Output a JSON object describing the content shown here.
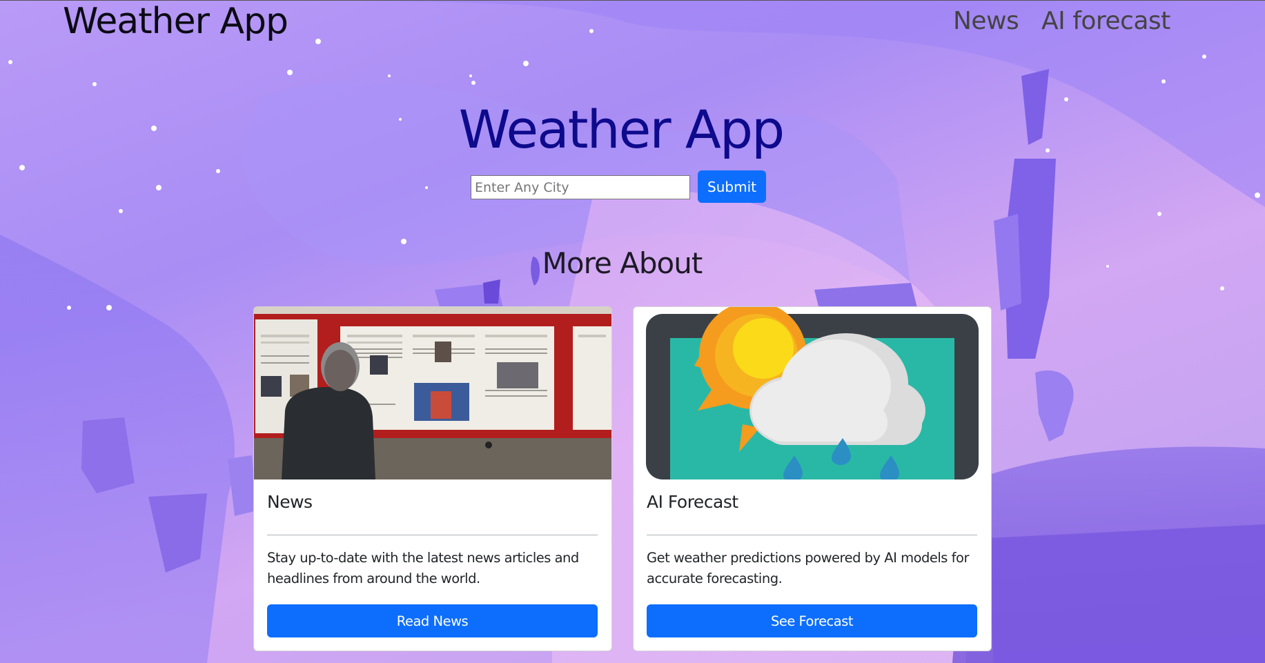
{
  "header": {
    "brand": "Weather App",
    "nav": [
      {
        "label": "News"
      },
      {
        "label": "AI forecast"
      }
    ]
  },
  "hero": {
    "title": "Weather App",
    "search_placeholder": "Enter Any City",
    "search_value": "",
    "submit_label": "Submit"
  },
  "section": {
    "title": "More About"
  },
  "cards": [
    {
      "title": "News",
      "text": "Stay up-to-date with the latest news articles and headlines from around the world.",
      "button_label": "Read News",
      "image": "newspaper-board-photo"
    },
    {
      "title": "AI Forecast",
      "text": "Get weather predictions powered by AI models for accurate forecasting.",
      "button_label": "See Forecast",
      "image": "weather-screen-illustration"
    }
  ],
  "colors": {
    "accent": "#0d6efd",
    "hero_title": "#0d0a8c",
    "background": "#b99af7"
  }
}
